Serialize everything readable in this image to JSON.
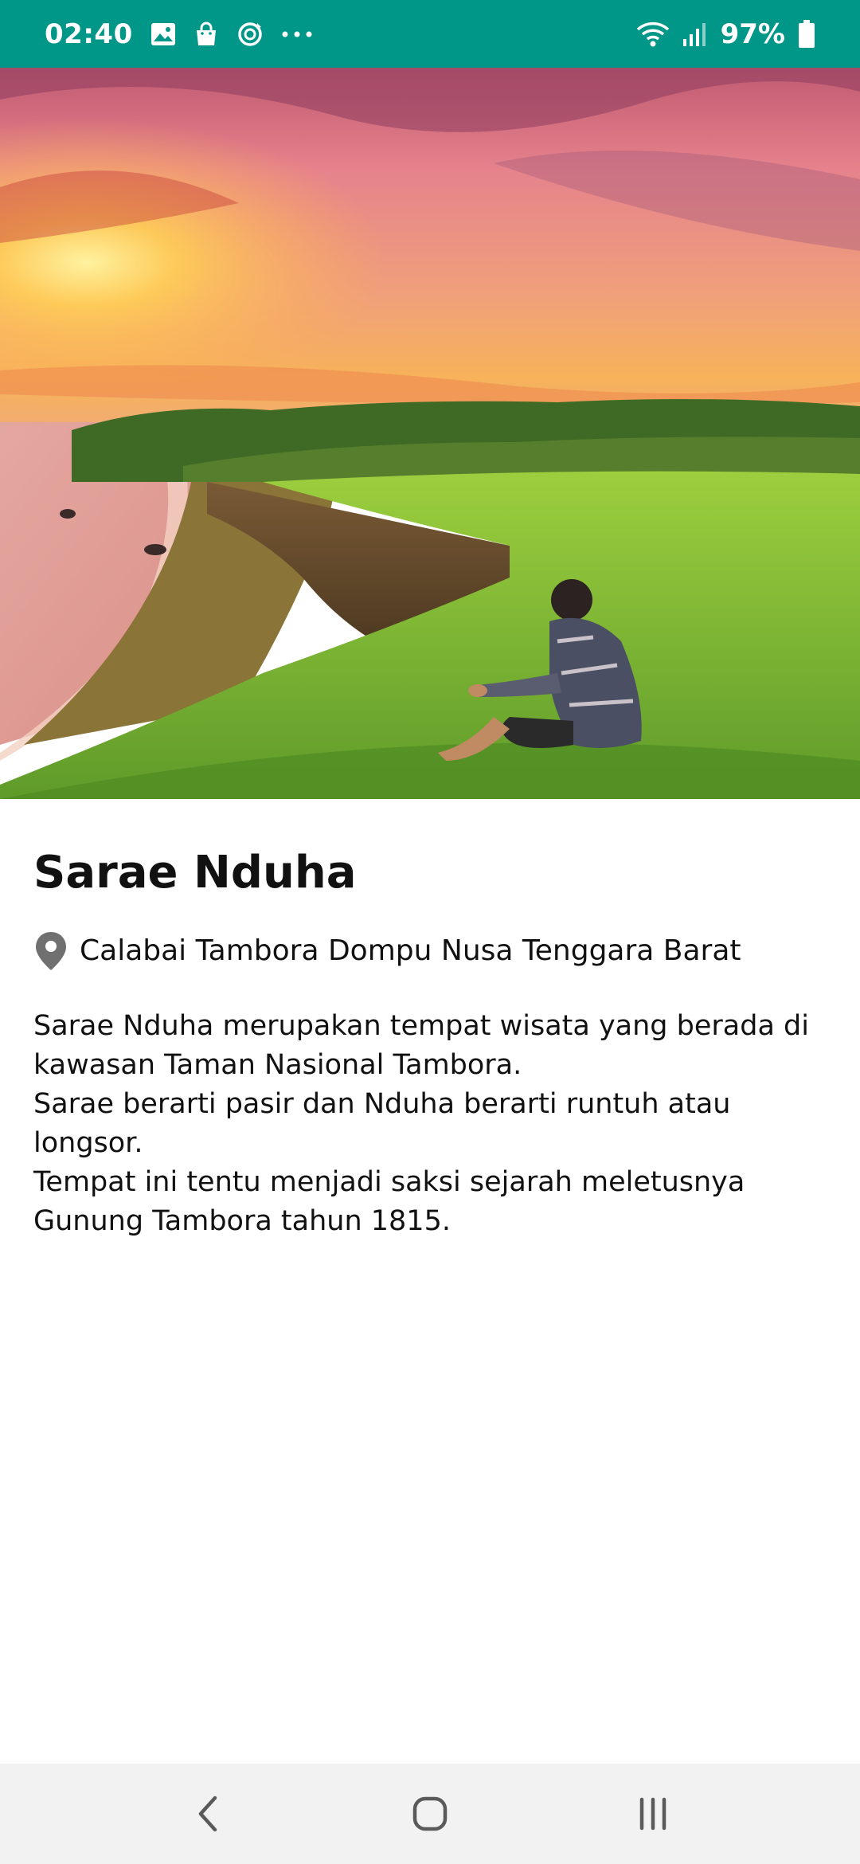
{
  "status_bar": {
    "time": "02:40",
    "battery": "97%",
    "left_icons": [
      "image-icon",
      "shopping-bag-icon",
      "sync-icon",
      "more-dots-icon"
    ],
    "right_icons": [
      "wifi-icon",
      "signal-icon",
      "battery-icon"
    ],
    "background_color": "#009688"
  },
  "hero": {
    "scene": "sunset-coastal-cliff-hill-person-sitting"
  },
  "place": {
    "title": "Sarae Nduha",
    "location": "Calabai Tambora Dompu Nusa Tenggara Barat",
    "location_icon": "location-pin-icon",
    "description": "Sarae Nduha merupakan tempat wisata yang berada di kawasan Taman Nasional Tambora.\nSarae berarti pasir dan Nduha berarti runtuh atau longsor.\nTempat ini tentu menjadi saksi sejarah meletusnya Gunung Tambora tahun 1815."
  },
  "nav_bar": {
    "buttons": [
      "back-icon",
      "home-icon",
      "recent-apps-icon"
    ]
  }
}
